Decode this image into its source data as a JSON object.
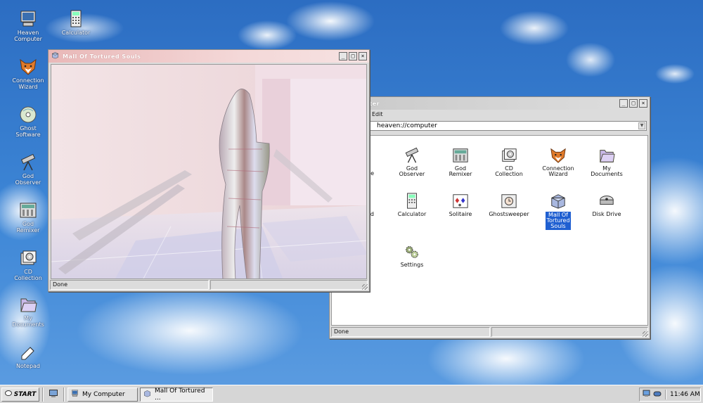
{
  "desktop": {
    "icons": [
      {
        "label": "Heaven\nComputer",
        "icon": "computer-icon"
      },
      {
        "label": "Calculator",
        "icon": "calculator-icon"
      },
      {
        "label": "Connection\nWizard",
        "icon": "fox-icon"
      },
      {
        "label": "Ghost\nSoftware",
        "icon": "ghost-cd-icon"
      },
      {
        "label": "God\nObserver",
        "icon": "telescope-icon"
      },
      {
        "label": "God\nRemixer",
        "icon": "remixer-icon"
      },
      {
        "label": "CD\nCollection",
        "icon": "cd-collection-icon"
      },
      {
        "label": "My\nDocuments",
        "icon": "folder-icon"
      },
      {
        "label": "Notepad",
        "icon": "notepad-icon"
      }
    ]
  },
  "viewer_window": {
    "title": "Mall Of Tortured Souls",
    "status_left": "Done",
    "status_right": ""
  },
  "explorer_window": {
    "title_visible": "puter",
    "menu": [
      "Edit"
    ],
    "address": "heaven://computer",
    "partial_labels": [
      "e",
      "d"
    ],
    "files": [
      {
        "label": "God\nObserver",
        "icon": "telescope-icon"
      },
      {
        "label": "God\nRemixer",
        "icon": "remixer-icon"
      },
      {
        "label": "CD\nCollection",
        "icon": "cd-collection-icon"
      },
      {
        "label": "Connection\nWizard",
        "icon": "fox-icon"
      },
      {
        "label": "My\nDocuments",
        "icon": "folder-icon"
      },
      {
        "label": "Calculator",
        "icon": "calculator-icon"
      },
      {
        "label": "Solitaire",
        "icon": "cards-icon"
      },
      {
        "label": "Ghostsweeper",
        "icon": "ghostsweeper-icon"
      },
      {
        "label": "Mall Of\nTortured\nSouls",
        "icon": "mall-icon",
        "selected": true
      },
      {
        "label": "Disk Drive",
        "icon": "disk-drive-icon"
      },
      {
        "label": "Settings",
        "icon": "gears-icon"
      }
    ],
    "status_left": "Done",
    "status_right": ""
  },
  "taskbar": {
    "start_label": "START",
    "tasks": [
      {
        "label": "My Computer",
        "icon": "computer-icon",
        "pressed": false
      },
      {
        "label": "Mall Of Tortured ...",
        "icon": "mall-icon",
        "pressed": true
      }
    ],
    "clock": "11:46 AM"
  },
  "colors": {
    "sky": "#2f73c4",
    "title_active": "#e9b8b8",
    "selection": "#1f5fd1",
    "window_face": "#dcdcdc"
  }
}
